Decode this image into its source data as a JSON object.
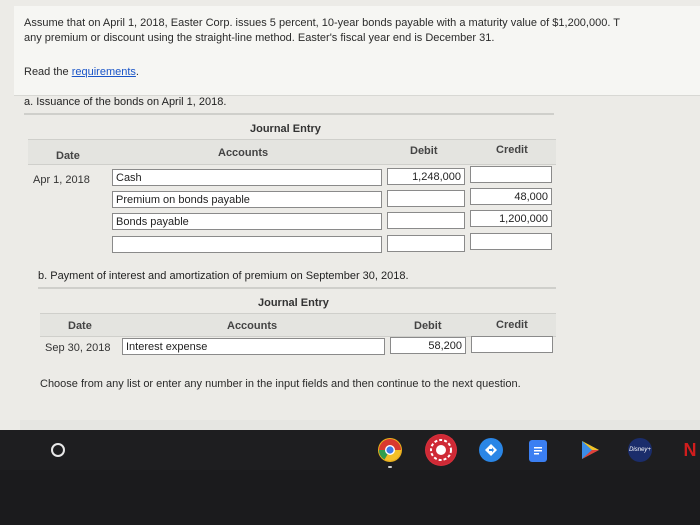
{
  "problem": {
    "line1": "Assume that on April 1, 2018, Easter Corp. issues 5 percent, 10-year bonds payable with a maturity value of $1,200,000. T",
    "line2": "any premium or discount using the straight-line method. Easter's fiscal year end is December 31.",
    "read_prefix": "Read the ",
    "requirements_link": "requirements",
    "read_suffix": "."
  },
  "part_a": {
    "title": "a. Issuance of the bonds on April 1, 2018.",
    "journal_title": "Journal Entry",
    "headers": {
      "date": "Date",
      "accounts": "Accounts",
      "debit": "Debit",
      "credit": "Credit"
    },
    "rows": [
      {
        "date": "Apr 1, 2018",
        "account": "Cash",
        "debit": "1,248,000",
        "credit": ""
      },
      {
        "date": "",
        "account": "Premium on bonds payable",
        "debit": "",
        "credit": "48,000"
      },
      {
        "date": "",
        "account": "Bonds payable",
        "debit": "",
        "credit": "1,200,000"
      },
      {
        "date": "",
        "account": "",
        "debit": "",
        "credit": ""
      }
    ]
  },
  "part_b": {
    "title": "b. Payment of interest and amortization of premium on September 30, 2018.",
    "journal_title": "Journal Entry",
    "headers": {
      "date": "Date",
      "accounts": "Accounts",
      "debit": "Debit",
      "credit": "Credit"
    },
    "rows": [
      {
        "date": "Sep 30, 2018",
        "account": "Interest expense",
        "debit": "58,200",
        "credit": ""
      }
    ]
  },
  "instruction": "Choose from any list or enter any number in the input fields and then continue to the next question.",
  "shelf": {
    "apps": [
      {
        "name": "Chrome",
        "icon": "chrome-icon",
        "color": "#e8b21c"
      },
      {
        "name": "Webex",
        "icon": "webex-icon",
        "color": "#d8303b"
      },
      {
        "name": "Maps",
        "icon": "maps-icon",
        "color": "#2a86e6"
      },
      {
        "name": "Docs",
        "icon": "docs-icon",
        "color": "#3b7ff2"
      },
      {
        "name": "Play",
        "icon": "play-icon",
        "color": "#2ea36b"
      },
      {
        "name": "Disney+",
        "icon": "disney-icon",
        "color": "#1b2d6b"
      },
      {
        "name": "Netflix",
        "icon": "netflix-icon",
        "color": "#d11d1d"
      }
    ],
    "disney_label": "Disney+",
    "netflix_label": "N"
  }
}
